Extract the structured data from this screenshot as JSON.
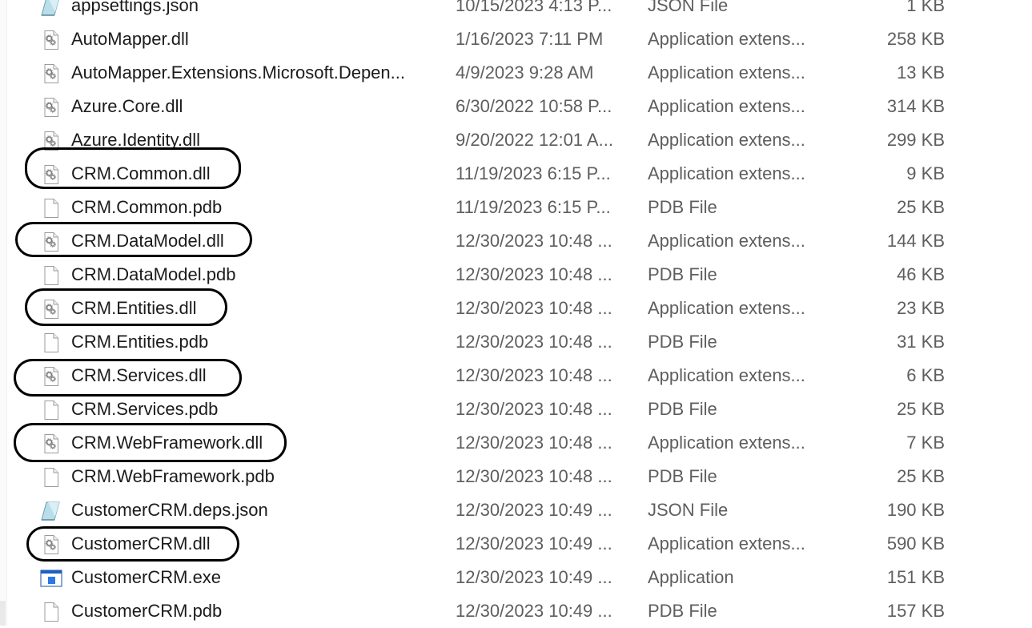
{
  "files": [
    {
      "name": "appsettings.json",
      "modified": "10/15/2023 4:13 P...",
      "type": "JSON File",
      "size": "1 KB",
      "icon": "json-file-icon"
    },
    {
      "name": "AutoMapper.dll",
      "modified": "1/16/2023 7:11 PM",
      "type": "Application extens...",
      "size": "258 KB",
      "icon": "dll-file-icon"
    },
    {
      "name": "AutoMapper.Extensions.Microsoft.Depen...",
      "modified": "4/9/2023 9:28 AM",
      "type": "Application extens...",
      "size": "13 KB",
      "icon": "dll-file-icon"
    },
    {
      "name": "Azure.Core.dll",
      "modified": "6/30/2022 10:58 P...",
      "type": "Application extens...",
      "size": "314 KB",
      "icon": "dll-file-icon"
    },
    {
      "name": "Azure.Identity.dll",
      "modified": "9/20/2022 12:01 A...",
      "type": "Application extens...",
      "size": "299 KB",
      "icon": "dll-file-icon"
    },
    {
      "name": "CRM.Common.dll",
      "modified": "11/19/2023 6:15 P...",
      "type": "Application extens...",
      "size": "9 KB",
      "icon": "dll-file-icon",
      "circled": true
    },
    {
      "name": "CRM.Common.pdb",
      "modified": "11/19/2023 6:15 P...",
      "type": "PDB File",
      "size": "25 KB",
      "icon": "blank-file-icon"
    },
    {
      "name": "CRM.DataModel.dll",
      "modified": "12/30/2023 10:48 ...",
      "type": "Application extens...",
      "size": "144 KB",
      "icon": "dll-file-icon",
      "circled": true
    },
    {
      "name": "CRM.DataModel.pdb",
      "modified": "12/30/2023 10:48 ...",
      "type": "PDB File",
      "size": "46 KB",
      "icon": "blank-file-icon"
    },
    {
      "name": "CRM.Entities.dll",
      "modified": "12/30/2023 10:48 ...",
      "type": "Application extens...",
      "size": "23 KB",
      "icon": "dll-file-icon",
      "circled": true
    },
    {
      "name": "CRM.Entities.pdb",
      "modified": "12/30/2023 10:48 ...",
      "type": "PDB File",
      "size": "31 KB",
      "icon": "blank-file-icon"
    },
    {
      "name": "CRM.Services.dll",
      "modified": "12/30/2023 10:48 ...",
      "type": "Application extens...",
      "size": "6 KB",
      "icon": "dll-file-icon",
      "circled": true
    },
    {
      "name": "CRM.Services.pdb",
      "modified": "12/30/2023 10:48 ...",
      "type": "PDB File",
      "size": "25 KB",
      "icon": "blank-file-icon"
    },
    {
      "name": "CRM.WebFramework.dll",
      "modified": "12/30/2023 10:48 ...",
      "type": "Application extens...",
      "size": "7 KB",
      "icon": "dll-file-icon",
      "circled": true
    },
    {
      "name": "CRM.WebFramework.pdb",
      "modified": "12/30/2023 10:48 ...",
      "type": "PDB File",
      "size": "25 KB",
      "icon": "blank-file-icon"
    },
    {
      "name": "CustomerCRM.deps.json",
      "modified": "12/30/2023 10:49 ...",
      "type": "JSON File",
      "size": "190 KB",
      "icon": "json-file-icon"
    },
    {
      "name": "CustomerCRM.dll",
      "modified": "12/30/2023 10:49 ...",
      "type": "Application extens...",
      "size": "590 KB",
      "icon": "dll-file-icon",
      "circled": true
    },
    {
      "name": "CustomerCRM.exe",
      "modified": "12/30/2023 10:49 ...",
      "type": "Application",
      "size": "151 KB",
      "icon": "exe-file-icon"
    },
    {
      "name": "CustomerCRM.pdb",
      "modified": "12/30/2023 10:49 ...",
      "type": "PDB File",
      "size": "157 KB",
      "icon": "blank-file-icon"
    }
  ],
  "colors": {
    "annotation": "#000000",
    "secondary_text": "#5e5e5e",
    "primary_text": "#1b1b1b"
  }
}
